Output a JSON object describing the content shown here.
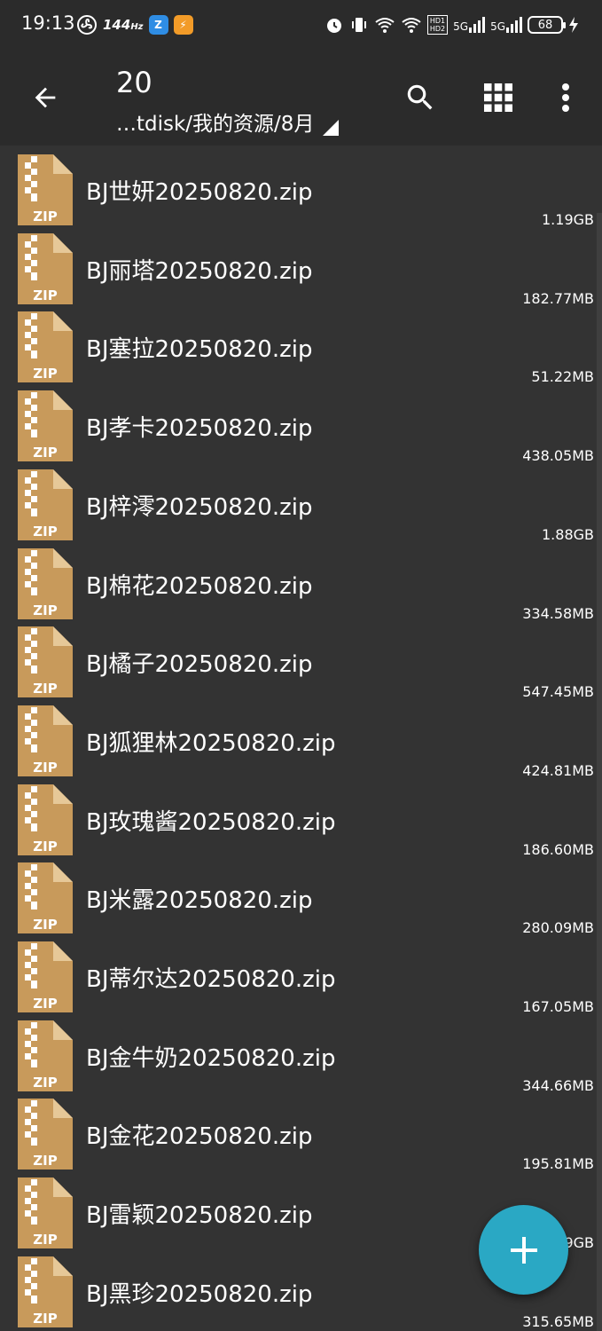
{
  "status_bar": {
    "time": "19:13",
    "refresh_rate": "144",
    "refresh_unit": "Hz",
    "network": "5G",
    "battery": "68"
  },
  "toolbar": {
    "title": "20",
    "path": "…tdisk/我的资源/8月"
  },
  "files": [
    {
      "name": "BJ世妍20250820.zip",
      "size": "1.19GB"
    },
    {
      "name": "BJ丽塔20250820.zip",
      "size": "182.77MB"
    },
    {
      "name": "BJ塞拉20250820.zip",
      "size": "51.22MB"
    },
    {
      "name": "BJ孝卡20250820.zip",
      "size": "438.05MB"
    },
    {
      "name": "BJ梓澪20250820.zip",
      "size": "1.88GB"
    },
    {
      "name": "BJ棉花20250820.zip",
      "size": "334.58MB"
    },
    {
      "name": "BJ橘子20250820.zip",
      "size": "547.45MB"
    },
    {
      "name": "BJ狐狸林20250820.zip",
      "size": "424.81MB"
    },
    {
      "name": "BJ玫瑰酱20250820.zip",
      "size": "186.60MB"
    },
    {
      "name": "BJ米露20250820.zip",
      "size": "280.09MB"
    },
    {
      "name": "BJ蒂尔达20250820.zip",
      "size": "167.05MB"
    },
    {
      "name": "BJ金牛奶20250820.zip",
      "size": "344.66MB"
    },
    {
      "name": "BJ金花20250820.zip",
      "size": "195.81MB"
    },
    {
      "name": "BJ雷颖20250820.zip",
      "size": "9GB"
    },
    {
      "name": "BJ黑珍20250820.zip",
      "size": "315.65MB"
    }
  ],
  "icon_label": "ZIP",
  "colors": {
    "background": "#333333",
    "toolbar": "#2b2b2b",
    "zip_icon": "#c89a5b",
    "fab": "#2aa8c4"
  }
}
